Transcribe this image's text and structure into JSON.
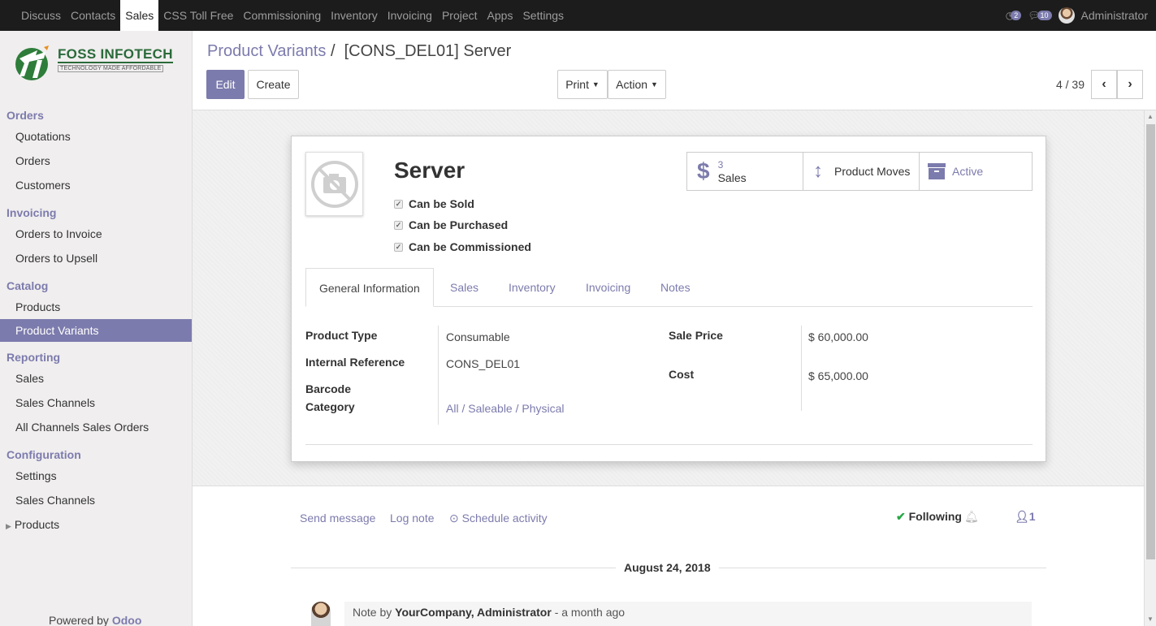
{
  "topbar": {
    "menu": [
      "Discuss",
      "Contacts",
      "Sales",
      "CSS Toll Free",
      "Commissioning",
      "Inventory",
      "Invoicing",
      "Project",
      "Apps",
      "Settings"
    ],
    "active_menu": "Sales",
    "activity_count": "2",
    "message_count": "10",
    "user": "Administrator"
  },
  "logo": {
    "name": "FOSS INFOTECH",
    "tagline": "TECHNOLOGY MADE AFFORDABLE"
  },
  "sidebar": {
    "sections": [
      {
        "title": "Orders",
        "items": [
          "Quotations",
          "Orders",
          "Customers"
        ]
      },
      {
        "title": "Invoicing",
        "items": [
          "Orders to Invoice",
          "Orders to Upsell"
        ]
      },
      {
        "title": "Catalog",
        "items": [
          "Products",
          "Product Variants"
        ]
      },
      {
        "title": "Reporting",
        "items": [
          "Sales",
          "Sales Channels",
          "All Channels Sales Orders"
        ]
      },
      {
        "title": "Configuration",
        "items": [
          "Settings",
          "Sales Channels",
          "Products"
        ]
      }
    ],
    "active_item": "Product Variants",
    "powered_by": "Powered by",
    "powered_brand": "Odoo"
  },
  "control_panel": {
    "breadcrumb_parent": "Product Variants",
    "breadcrumb_sep": "/",
    "breadcrumb_current": "[CONS_DEL01] Server",
    "edit_label": "Edit",
    "create_label": "Create",
    "print_label": "Print",
    "action_label": "Action",
    "pager": "4 / 39"
  },
  "form": {
    "name": "Server",
    "checkboxes": [
      "Can be Sold",
      "Can be Purchased",
      "Can be Commissioned"
    ],
    "smart_buttons": {
      "sales_count": "3",
      "sales_label": "Sales",
      "moves_label": "Product Moves",
      "active_label": "Active"
    },
    "tabs": [
      "General Information",
      "Sales",
      "Inventory",
      "Invoicing",
      "Notes"
    ],
    "active_tab": "General Information",
    "fields": {
      "product_type_label": "Product Type",
      "product_type": "Consumable",
      "internal_ref_label": "Internal Reference",
      "internal_ref": "CONS_DEL01",
      "barcode_label": "Barcode",
      "category_label": "Category",
      "category": "All / Saleable / Physical",
      "sale_price_label": "Sale Price",
      "sale_price": "$ 60,000.00",
      "cost_label": "Cost",
      "cost": "$ 65,000.00"
    }
  },
  "chatter": {
    "send_message": "Send message",
    "log_note": "Log note",
    "schedule_activity": "Schedule activity",
    "following": "Following",
    "followers_count": "1",
    "date": "August 24, 2018",
    "message_prefix": "Note by",
    "message_author": "YourCompany, Administrator",
    "message_time": "- a month ago"
  },
  "colors": {
    "accent": "#7c7bad",
    "topbar": "#1c1c1c",
    "sidebar": "#f0eeee"
  }
}
